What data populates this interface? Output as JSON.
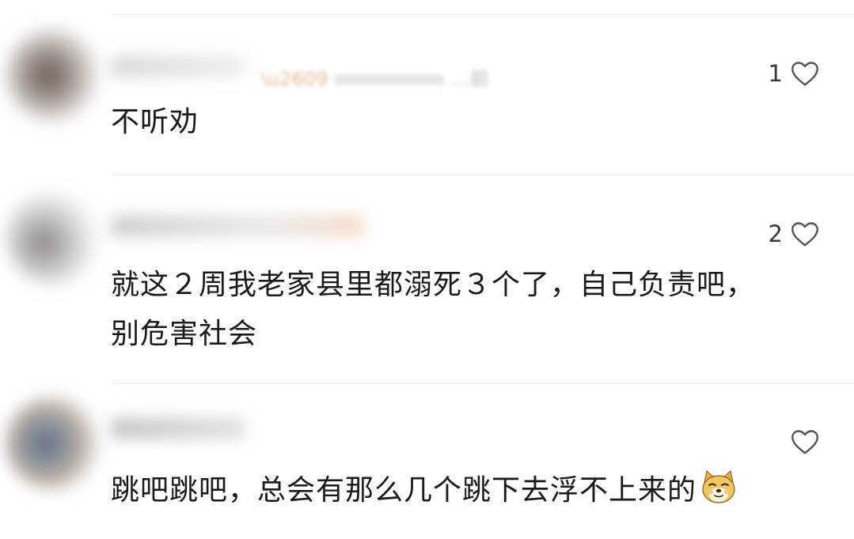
{
  "comments": [
    {
      "meta_blurred": "…前",
      "likes": "1",
      "text": "不听劝"
    },
    {
      "likes": "2",
      "text_line1": "就这２周我老家县里都溺死３个了，自己负责吧，",
      "text_line2": "别危害社会"
    },
    {
      "likes": "",
      "text": "跳吧跳吧，总会有那么几个跳下去浮不上来的"
    }
  ],
  "icons": {
    "like": "heart-outline-icon",
    "emoji": "doge-emoji-icon"
  },
  "colors": {
    "text": "#1a1a1a",
    "divider": "#ebebeb",
    "icon": "#555555"
  }
}
